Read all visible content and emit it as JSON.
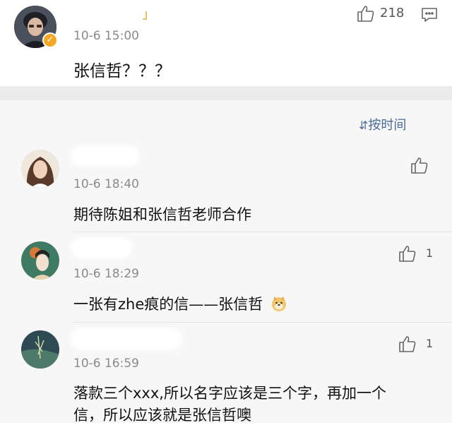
{
  "post": {
    "time": "10-6 15:00",
    "text": "张信哲？？？",
    "like_count": "218",
    "icons": {
      "like": "thumbs-up-icon",
      "comment": "comment-icon",
      "verified": "verified-badge-icon"
    }
  },
  "sort_label": "按时间",
  "comments": [
    {
      "time": "10-6 18:40",
      "text": "期待陈姐和张信哲老师合作",
      "like_count": ""
    },
    {
      "time": "10-6 18:29",
      "text": "一张有zhe痕的信——张信哲",
      "like_count": "1"
    },
    {
      "time": "10-6 16:59",
      "text_line1": "落款三个xxx,所以名字应该是三个字，再加一个",
      "text_line2": "信，所以应该就是张信哲噢",
      "like_count": "1"
    }
  ],
  "colors": {
    "accent_blue": "#4a6b9a",
    "badge_orange": "#f5a623",
    "meta_gray": "#8a8a8a"
  }
}
